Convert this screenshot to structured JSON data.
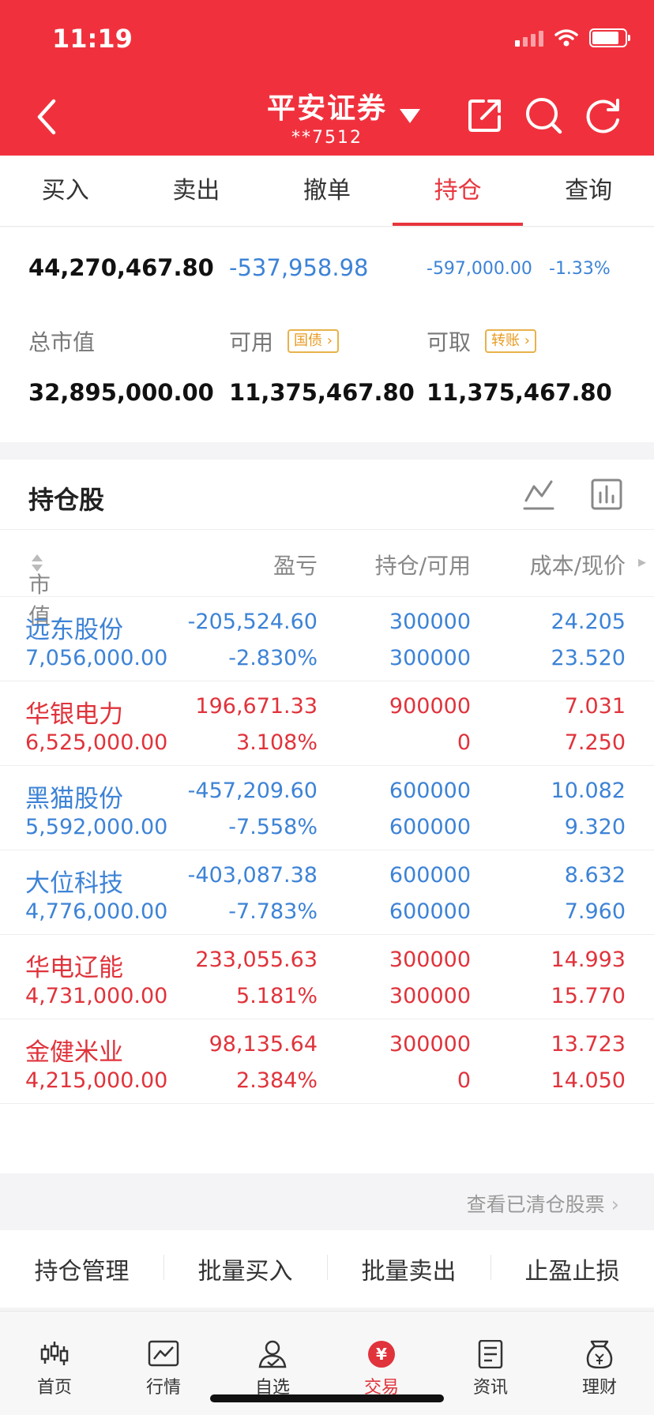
{
  "status_bar": {
    "time": "11:19"
  },
  "header": {
    "broker_name": "平安证券",
    "account": "**7512"
  },
  "tabs": [
    {
      "label": "买入"
    },
    {
      "label": "卖出"
    },
    {
      "label": "撤单"
    },
    {
      "label": "持仓",
      "active": true
    },
    {
      "label": "查询"
    }
  ],
  "summary": {
    "total_assets": "44,270,467.80",
    "floating_pl": "-537,958.98",
    "today_pl": "-597,000.00",
    "today_pl_pct": "-1.33%",
    "market_value_label": "总市值",
    "available_label": "可用",
    "available_tag": "国债",
    "withdrawable_label": "可取",
    "withdrawable_tag": "转账",
    "market_value": "32,895,000.00",
    "available": "11,375,467.80",
    "withdrawable": "11,375,467.80"
  },
  "holdings": {
    "title": "持仓股",
    "columns": {
      "market_value": "市值",
      "pl": "盈亏",
      "position": "持仓/可用",
      "cost": "成本/现价"
    },
    "rows": [
      {
        "name": "远东股份",
        "market_value": "7,056,000.00",
        "pl": "-205,524.60",
        "pl_pct": "-2.830%",
        "position": "300000",
        "available": "300000",
        "cost": "24.205",
        "price": "23.520",
        "trend": "down"
      },
      {
        "name": "华银电力",
        "market_value": "6,525,000.00",
        "pl": "196,671.33",
        "pl_pct": "3.108%",
        "position": "900000",
        "available": "0",
        "cost": "7.031",
        "price": "7.250",
        "trend": "up"
      },
      {
        "name": "黑猫股份",
        "market_value": "5,592,000.00",
        "pl": "-457,209.60",
        "pl_pct": "-7.558%",
        "position": "600000",
        "available": "600000",
        "cost": "10.082",
        "price": "9.320",
        "trend": "down"
      },
      {
        "name": "大位科技",
        "market_value": "4,776,000.00",
        "pl": "-403,087.38",
        "pl_pct": "-7.783%",
        "position": "600000",
        "available": "600000",
        "cost": "8.632",
        "price": "7.960",
        "trend": "down"
      },
      {
        "name": "华电辽能",
        "market_value": "4,731,000.00",
        "pl": "233,055.63",
        "pl_pct": "5.181%",
        "position": "300000",
        "available": "300000",
        "cost": "14.993",
        "price": "15.770",
        "trend": "up"
      },
      {
        "name": "金健米业",
        "market_value": "4,215,000.00",
        "pl": "98,135.64",
        "pl_pct": "2.384%",
        "position": "300000",
        "available": "0",
        "cost": "13.723",
        "price": "14.050",
        "trend": "up"
      }
    ],
    "cleared_link": "查看已清仓股票"
  },
  "actions": [
    {
      "label": "持仓管理"
    },
    {
      "label": "批量买入"
    },
    {
      "label": "批量卖出"
    },
    {
      "label": "止盈止损"
    }
  ],
  "bottom_nav": [
    {
      "label": "首页",
      "icon": "candlestick-icon"
    },
    {
      "label": "行情",
      "icon": "chart-icon"
    },
    {
      "label": "自选",
      "icon": "user-check-icon"
    },
    {
      "label": "交易",
      "icon": "yuan-icon",
      "active": true
    },
    {
      "label": "资讯",
      "icon": "document-icon"
    },
    {
      "label": "理财",
      "icon": "money-bag-icon"
    }
  ],
  "colors": {
    "brand_red": "#f0313d",
    "up": "#e0333b",
    "down": "#3d83d6",
    "tag": "#e89a1f"
  }
}
